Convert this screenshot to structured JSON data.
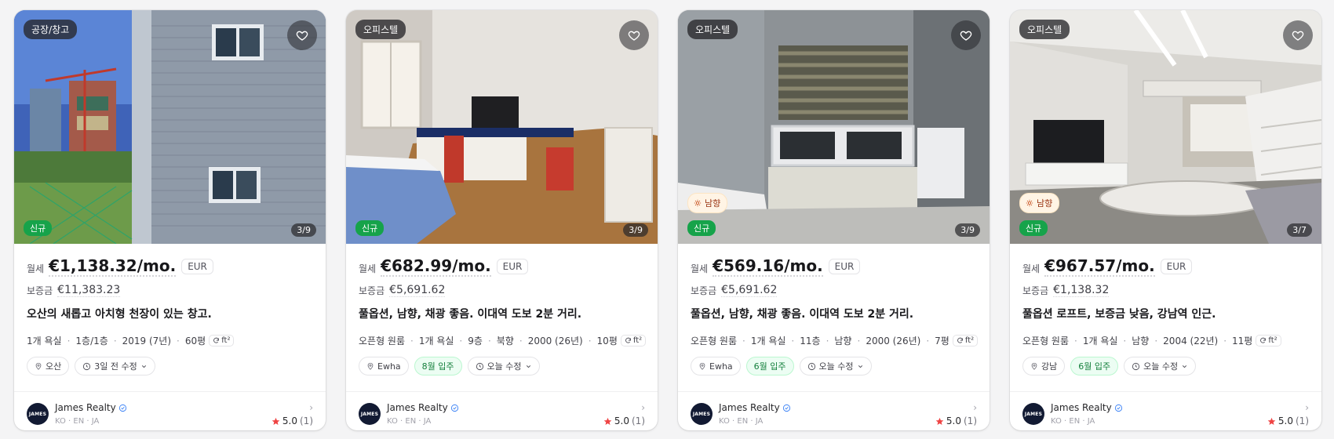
{
  "colors": {
    "new_badge": "#16a34a",
    "move_in_chip": "#ecfdf3",
    "star": "#ef4444",
    "verified": "#3b82f6"
  },
  "icons": [
    "heart-icon",
    "sun-icon",
    "pin-icon",
    "clock-icon",
    "chevron-down-icon",
    "refresh-icon",
    "verified-icon",
    "chevron-right-icon",
    "star-icon"
  ],
  "listings": [
    {
      "type": "공장/창고",
      "sun": "",
      "new": "신규",
      "photo_count": "3/9",
      "rent_label": "월세",
      "price": "€1,138.32/mo.",
      "currency": "EUR",
      "deposit_label": "보증금",
      "deposit": "€11,383.23",
      "title": "오산의 새롭고 아치형 천장이 있는 창고.",
      "specs": [
        "1개 욕실",
        "1층/1층",
        "2019 (7년)",
        "60평"
      ],
      "unit_toggle": "ft²",
      "location": "오산",
      "move_in": "",
      "updated": "3일 전 수정",
      "agent": {
        "name": "James Realty",
        "langs": "KO · EN · JA",
        "avatar_text": "JAMES",
        "rating": "5.0",
        "reviews": "(1)"
      }
    },
    {
      "type": "오피스텔",
      "sun": "",
      "new": "신규",
      "photo_count": "3/9",
      "rent_label": "월세",
      "price": "€682.99/mo.",
      "currency": "EUR",
      "deposit_label": "보증금",
      "deposit": "€5,691.62",
      "title": "풀옵션, 남향, 채광 좋음. 이대역 도보 2분 거리.",
      "specs": [
        "오픈형 원룸",
        "1개 욕실",
        "9층",
        "북향",
        "2000 (26년)",
        "10평"
      ],
      "unit_toggle": "ft²",
      "location": "Ewha",
      "move_in": "8월 입주",
      "updated": "오늘 수정",
      "agent": {
        "name": "James Realty",
        "langs": "KO · EN · JA",
        "avatar_text": "JAMES",
        "rating": "5.0",
        "reviews": "(1)"
      }
    },
    {
      "type": "오피스텔",
      "sun": "남향",
      "new": "신규",
      "photo_count": "3/9",
      "rent_label": "월세",
      "price": "€569.16/mo.",
      "currency": "EUR",
      "deposit_label": "보증금",
      "deposit": "€5,691.62",
      "title": "풀옵션, 남향, 채광 좋음. 이대역 도보 2분 거리.",
      "specs": [
        "오픈형 원룸",
        "1개 욕실",
        "11층",
        "남향",
        "2000 (26년)",
        "7평"
      ],
      "unit_toggle": "ft²",
      "location": "Ewha",
      "move_in": "6월 입주",
      "updated": "오늘 수정",
      "agent": {
        "name": "James Realty",
        "langs": "KO · EN · JA",
        "avatar_text": "JAMES",
        "rating": "5.0",
        "reviews": "(1)"
      }
    },
    {
      "type": "오피스텔",
      "sun": "남향",
      "new": "신규",
      "photo_count": "3/7",
      "rent_label": "월세",
      "price": "€967.57/mo.",
      "currency": "EUR",
      "deposit_label": "보증금",
      "deposit": "€1,138.32",
      "title": "풀옵션 로프트, 보증금 낮음, 강남역 인근.",
      "specs": [
        "오픈형 원룸",
        "1개 욕실",
        "남향",
        "2004 (22년)",
        "11평"
      ],
      "unit_toggle": "ft²",
      "location": "강남",
      "move_in": "6월 입주",
      "updated": "오늘 수정",
      "agent": {
        "name": "James Realty",
        "langs": "KO · EN · JA",
        "avatar_text": "JAMES",
        "rating": "5.0",
        "reviews": "(1)"
      }
    }
  ]
}
